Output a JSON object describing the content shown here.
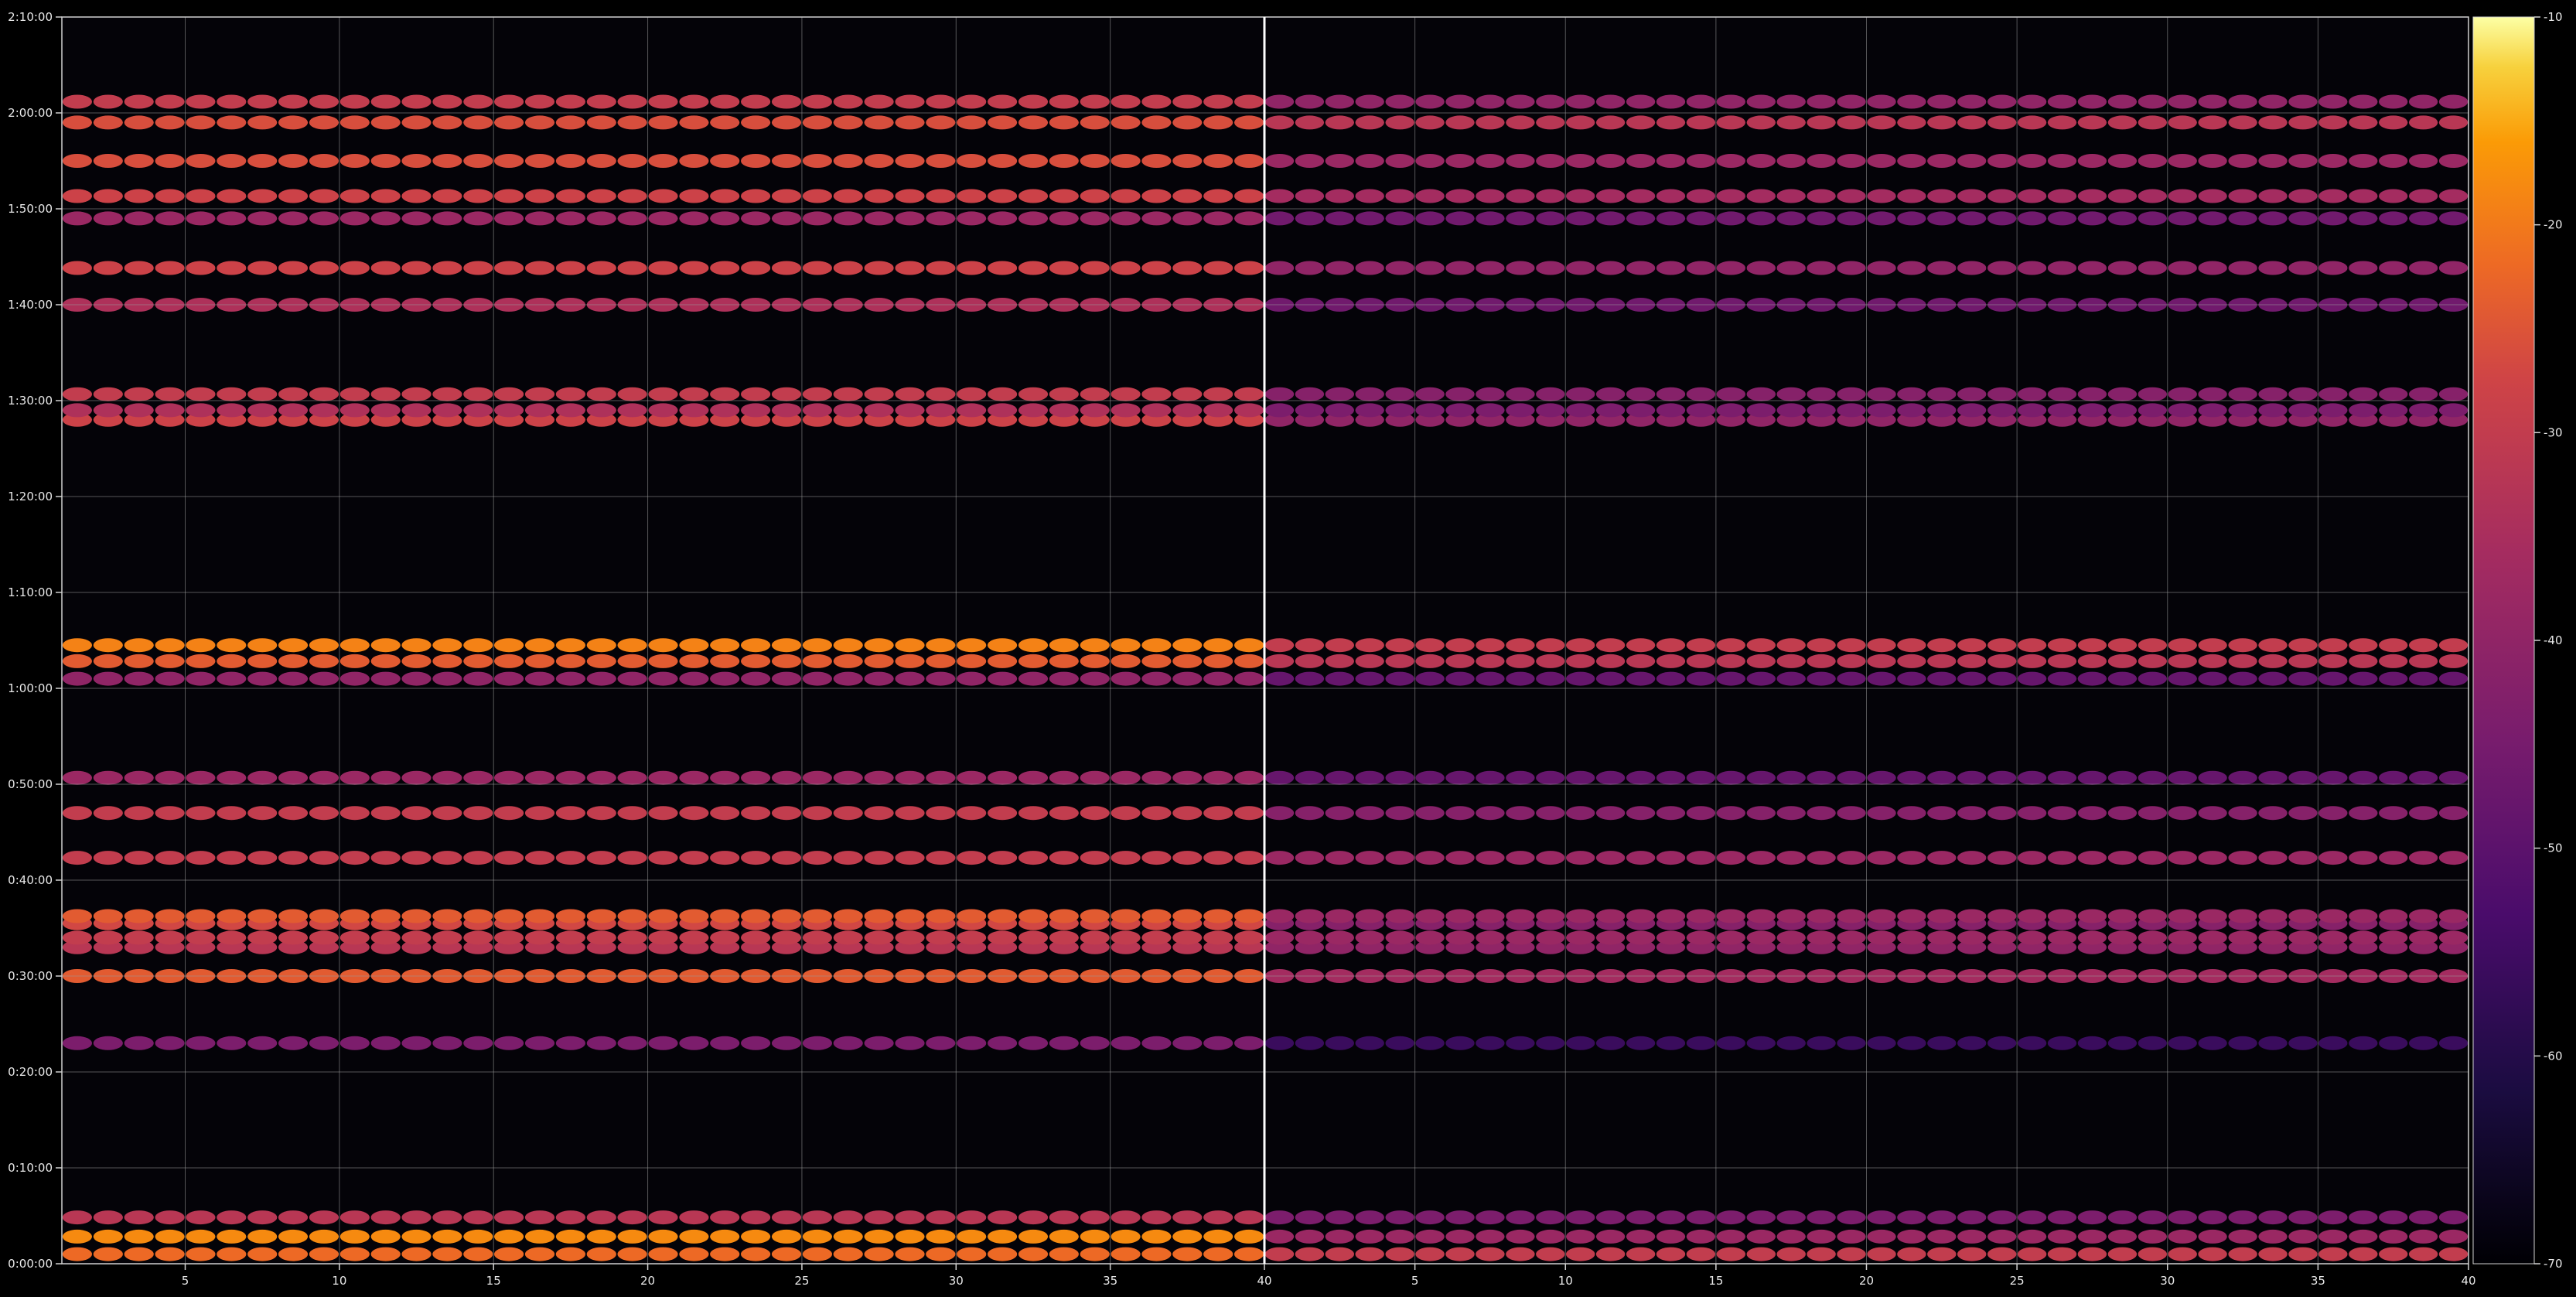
{
  "chart_data": {
    "type": "heatmap",
    "title": "",
    "xlabel": "",
    "ylabel": "",
    "panels": [
      {
        "name": "left",
        "x_range": [
          1,
          40
        ],
        "x_ticks": [
          5,
          10,
          15,
          20,
          25,
          30,
          35,
          40
        ],
        "x_tick_labels": [
          "5",
          "10",
          "15",
          "20",
          "25",
          "30",
          "35",
          "40"
        ]
      },
      {
        "name": "right",
        "x_range": [
          0,
          40
        ],
        "x_ticks": [
          5,
          10,
          15,
          20,
          25,
          30,
          35,
          40
        ],
        "x_tick_labels": [
          "5",
          "10",
          "15",
          "20",
          "25",
          "30",
          "35",
          "40"
        ]
      }
    ],
    "y_range_seconds": [
      0,
      7800
    ],
    "y_ticks_seconds": [
      0,
      600,
      1200,
      1800,
      2400,
      3000,
      3600,
      4200,
      4800,
      5400,
      6000,
      6600,
      7200,
      7800
    ],
    "y_tick_labels": [
      "0:00:00",
      "0:10:00",
      "0:20:00",
      "0:30:00",
      "0:40:00",
      "0:50:00",
      "1:00:00",
      "1:10:00",
      "1:20:00",
      "1:30:00",
      "1:40:00",
      "1:50:00",
      "2:00:00",
      "2:10:00"
    ],
    "colorbar": {
      "colormap": "inferno",
      "range": [
        -70,
        -10
      ],
      "ticks": [
        -10,
        -20,
        -30,
        -40,
        -50,
        -60,
        -70
      ],
      "tick_labels": [
        "-10",
        "-20",
        "-30",
        "-40",
        "-50",
        "-60",
        "-70"
      ]
    },
    "grid": true,
    "bands_seconds": [
      {
        "t": 60,
        "left": -22,
        "right": -30
      },
      {
        "t": 170,
        "left": -18,
        "right": -38
      },
      {
        "t": 290,
        "left": -32,
        "right": -44
      },
      {
        "t": 1380,
        "left": -44,
        "right": -56
      },
      {
        "t": 1800,
        "left": -24,
        "right": -36
      },
      {
        "t": 1980,
        "left": -32,
        "right": -40
      },
      {
        "t": 2040,
        "left": -30,
        "right": -38
      },
      {
        "t": 2130,
        "left": -27,
        "right": -42
      },
      {
        "t": 2175,
        "left": -24,
        "right": -38
      },
      {
        "t": 2540,
        "left": -30,
        "right": -38
      },
      {
        "t": 2820,
        "left": -30,
        "right": -42
      },
      {
        "t": 3040,
        "left": -38,
        "right": -48
      },
      {
        "t": 3660,
        "left": -40,
        "right": -48
      },
      {
        "t": 3770,
        "left": -24,
        "right": -32
      },
      {
        "t": 3870,
        "left": -19,
        "right": -30
      },
      {
        "t": 5280,
        "left": -28,
        "right": -40
      },
      {
        "t": 5340,
        "left": -34,
        "right": -44
      },
      {
        "t": 5440,
        "left": -30,
        "right": -42
      },
      {
        "t": 6000,
        "left": -34,
        "right": -46
      },
      {
        "t": 6230,
        "left": -28,
        "right": -40
      },
      {
        "t": 6540,
        "left": -38,
        "right": -46
      },
      {
        "t": 6680,
        "left": -28,
        "right": -36
      },
      {
        "t": 6900,
        "left": -26,
        "right": -38
      },
      {
        "t": 7140,
        "left": -26,
        "right": -32
      },
      {
        "t": 7270,
        "left": -30,
        "right": -40
      }
    ]
  }
}
